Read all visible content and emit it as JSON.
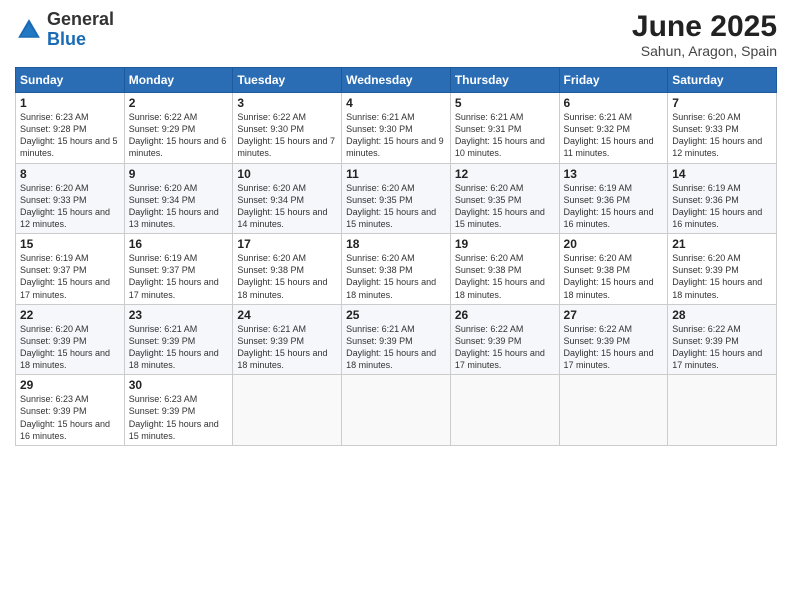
{
  "logo": {
    "general": "General",
    "blue": "Blue"
  },
  "title": "June 2025",
  "subtitle": "Sahun, Aragon, Spain",
  "days_of_week": [
    "Sunday",
    "Monday",
    "Tuesday",
    "Wednesday",
    "Thursday",
    "Friday",
    "Saturday"
  ],
  "weeks": [
    [
      {
        "day": 1,
        "sunrise": "6:23 AM",
        "sunset": "9:28 PM",
        "daylight": "15 hours and 5 minutes."
      },
      {
        "day": 2,
        "sunrise": "6:22 AM",
        "sunset": "9:29 PM",
        "daylight": "15 hours and 6 minutes."
      },
      {
        "day": 3,
        "sunrise": "6:22 AM",
        "sunset": "9:30 PM",
        "daylight": "15 hours and 7 minutes."
      },
      {
        "day": 4,
        "sunrise": "6:21 AM",
        "sunset": "9:30 PM",
        "daylight": "15 hours and 9 minutes."
      },
      {
        "day": 5,
        "sunrise": "6:21 AM",
        "sunset": "9:31 PM",
        "daylight": "15 hours and 10 minutes."
      },
      {
        "day": 6,
        "sunrise": "6:21 AM",
        "sunset": "9:32 PM",
        "daylight": "15 hours and 11 minutes."
      },
      {
        "day": 7,
        "sunrise": "6:20 AM",
        "sunset": "9:33 PM",
        "daylight": "15 hours and 12 minutes."
      }
    ],
    [
      {
        "day": 8,
        "sunrise": "6:20 AM",
        "sunset": "9:33 PM",
        "daylight": "15 hours and 12 minutes."
      },
      {
        "day": 9,
        "sunrise": "6:20 AM",
        "sunset": "9:34 PM",
        "daylight": "15 hours and 13 minutes."
      },
      {
        "day": 10,
        "sunrise": "6:20 AM",
        "sunset": "9:34 PM",
        "daylight": "15 hours and 14 minutes."
      },
      {
        "day": 11,
        "sunrise": "6:20 AM",
        "sunset": "9:35 PM",
        "daylight": "15 hours and 15 minutes."
      },
      {
        "day": 12,
        "sunrise": "6:20 AM",
        "sunset": "9:35 PM",
        "daylight": "15 hours and 15 minutes."
      },
      {
        "day": 13,
        "sunrise": "6:19 AM",
        "sunset": "9:36 PM",
        "daylight": "15 hours and 16 minutes."
      },
      {
        "day": 14,
        "sunrise": "6:19 AM",
        "sunset": "9:36 PM",
        "daylight": "15 hours and 16 minutes."
      }
    ],
    [
      {
        "day": 15,
        "sunrise": "6:19 AM",
        "sunset": "9:37 PM",
        "daylight": "15 hours and 17 minutes."
      },
      {
        "day": 16,
        "sunrise": "6:19 AM",
        "sunset": "9:37 PM",
        "daylight": "15 hours and 17 minutes."
      },
      {
        "day": 17,
        "sunrise": "6:20 AM",
        "sunset": "9:38 PM",
        "daylight": "15 hours and 18 minutes."
      },
      {
        "day": 18,
        "sunrise": "6:20 AM",
        "sunset": "9:38 PM",
        "daylight": "15 hours and 18 minutes."
      },
      {
        "day": 19,
        "sunrise": "6:20 AM",
        "sunset": "9:38 PM",
        "daylight": "15 hours and 18 minutes."
      },
      {
        "day": 20,
        "sunrise": "6:20 AM",
        "sunset": "9:38 PM",
        "daylight": "15 hours and 18 minutes."
      },
      {
        "day": 21,
        "sunrise": "6:20 AM",
        "sunset": "9:39 PM",
        "daylight": "15 hours and 18 minutes."
      }
    ],
    [
      {
        "day": 22,
        "sunrise": "6:20 AM",
        "sunset": "9:39 PM",
        "daylight": "15 hours and 18 minutes."
      },
      {
        "day": 23,
        "sunrise": "6:21 AM",
        "sunset": "9:39 PM",
        "daylight": "15 hours and 18 minutes."
      },
      {
        "day": 24,
        "sunrise": "6:21 AM",
        "sunset": "9:39 PM",
        "daylight": "15 hours and 18 minutes."
      },
      {
        "day": 25,
        "sunrise": "6:21 AM",
        "sunset": "9:39 PM",
        "daylight": "15 hours and 18 minutes."
      },
      {
        "day": 26,
        "sunrise": "6:22 AM",
        "sunset": "9:39 PM",
        "daylight": "15 hours and 17 minutes."
      },
      {
        "day": 27,
        "sunrise": "6:22 AM",
        "sunset": "9:39 PM",
        "daylight": "15 hours and 17 minutes."
      },
      {
        "day": 28,
        "sunrise": "6:22 AM",
        "sunset": "9:39 PM",
        "daylight": "15 hours and 17 minutes."
      }
    ],
    [
      {
        "day": 29,
        "sunrise": "6:23 AM",
        "sunset": "9:39 PM",
        "daylight": "15 hours and 16 minutes."
      },
      {
        "day": 30,
        "sunrise": "6:23 AM",
        "sunset": "9:39 PM",
        "daylight": "15 hours and 15 minutes."
      },
      null,
      null,
      null,
      null,
      null
    ]
  ]
}
